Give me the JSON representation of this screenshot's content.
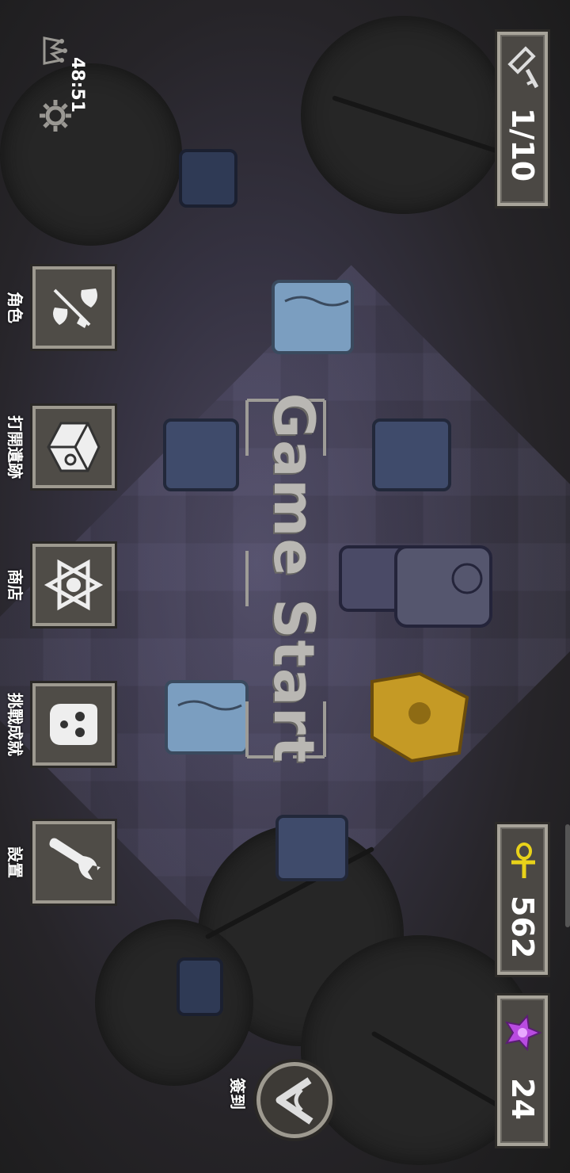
{
  "hud": {
    "keys_value": "1/10",
    "timer": "48:51",
    "ankh_value": "562",
    "gem_value": "24"
  },
  "center": {
    "start_label": "Game Start"
  },
  "menu": [
    {
      "label": "角色",
      "icon": "character-icon"
    },
    {
      "label": "打開遺跡",
      "icon": "ruin-box-icon"
    },
    {
      "label": "商店",
      "icon": "shop-hexagram-icon"
    },
    {
      "label": "挑戰成就",
      "icon": "achievement-icon"
    },
    {
      "label": "設置",
      "icon": "wrench-icon"
    }
  ],
  "signin": {
    "label": "簽到",
    "icon": "check-in-icon"
  },
  "colors": {
    "ankh": "#e8d21a",
    "gem": "#b84be0",
    "panel_border": "#a8a49a",
    "golden_totem": "#c59a25",
    "blue_block": "#6b86a8"
  }
}
